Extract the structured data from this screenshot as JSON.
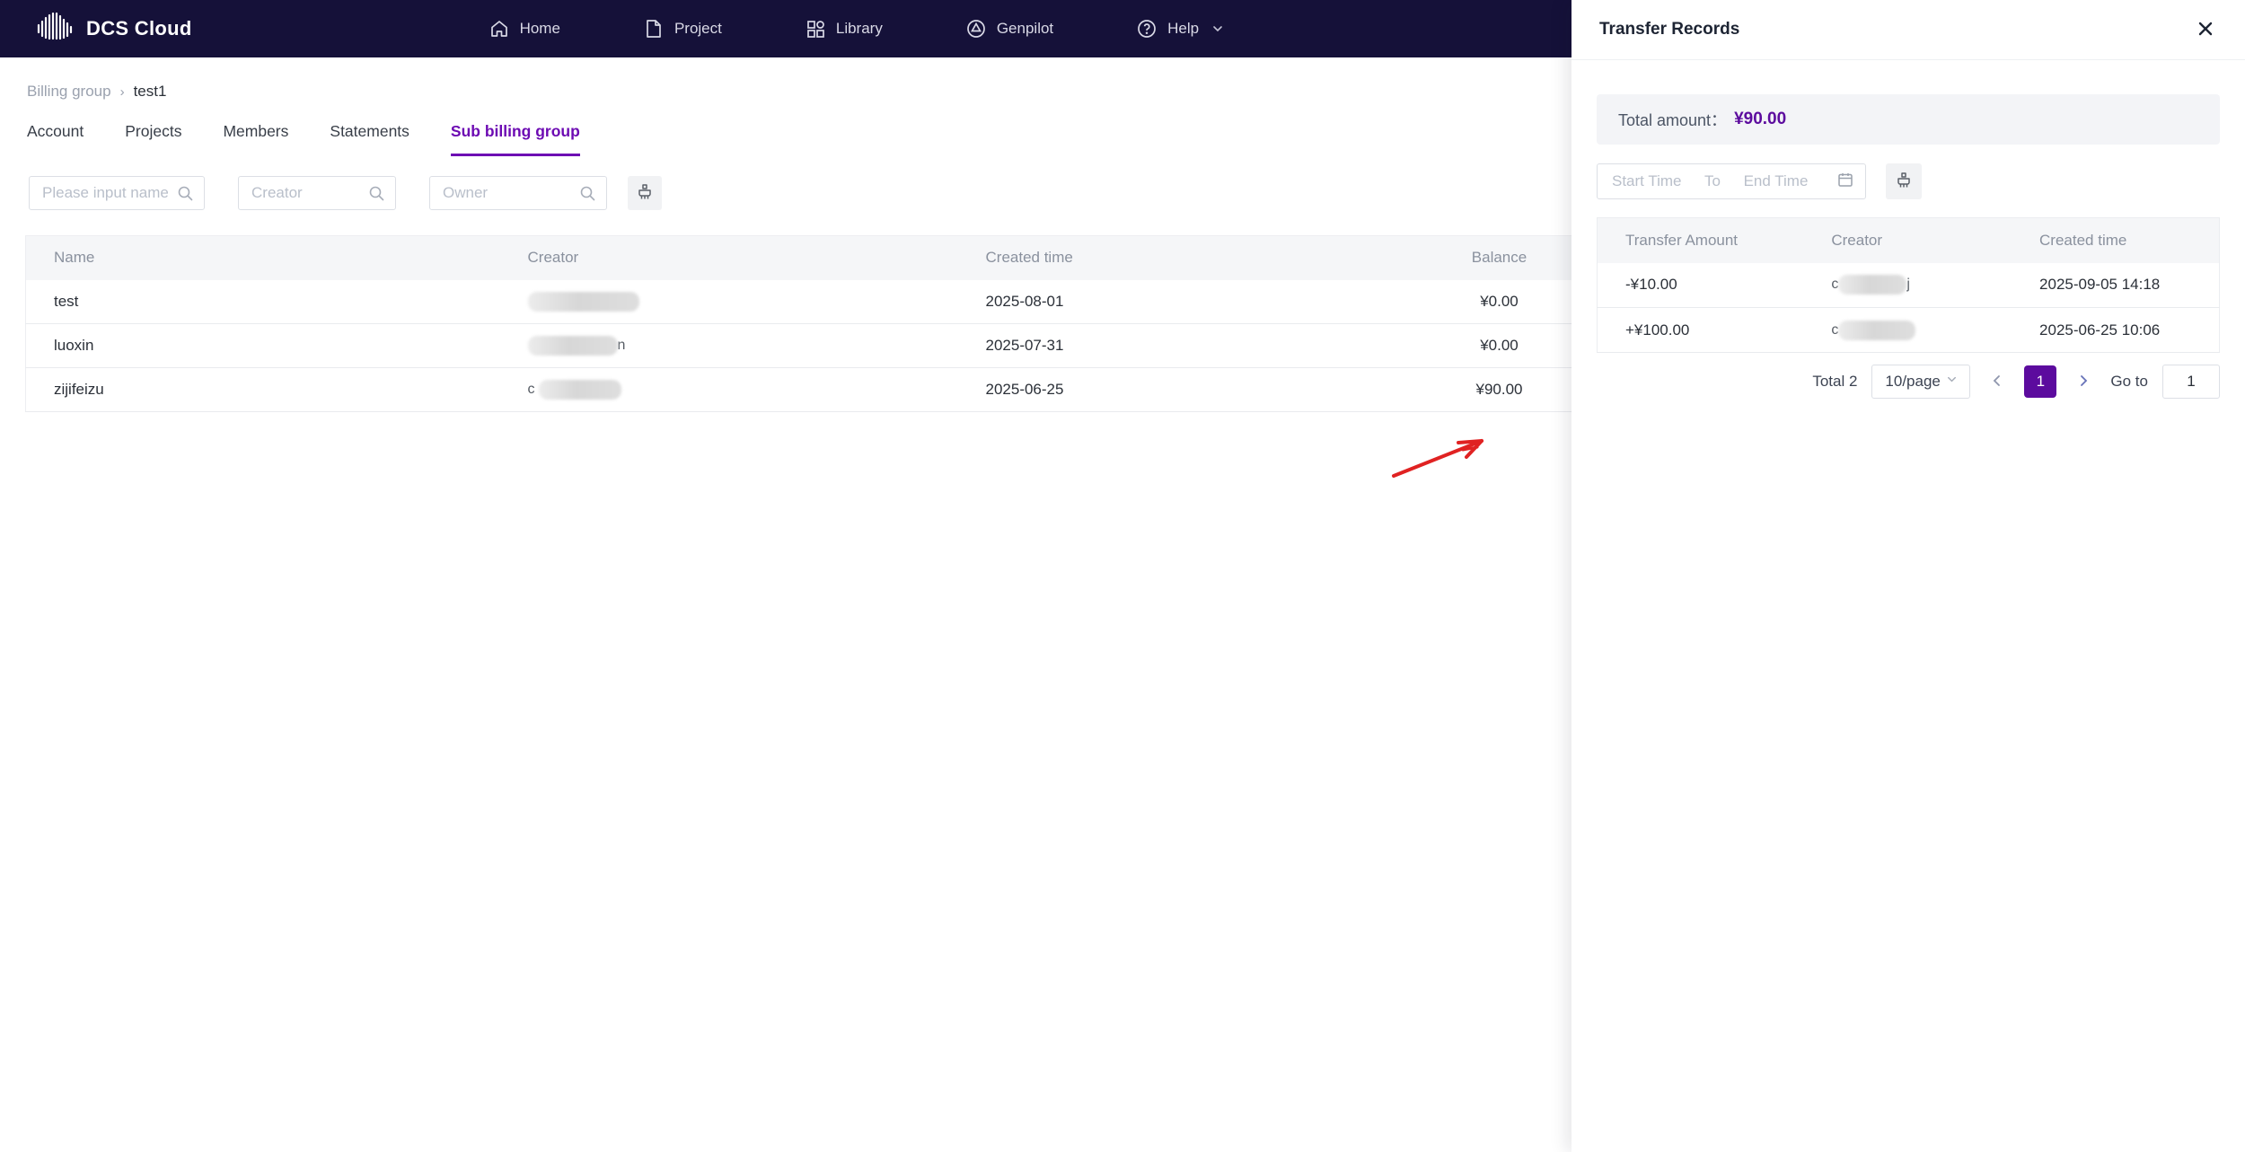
{
  "nav": {
    "brand": "DCS Cloud",
    "items": [
      {
        "label": "Home"
      },
      {
        "label": "Project"
      },
      {
        "label": "Library"
      },
      {
        "label": "Genpilot"
      },
      {
        "label": "Help"
      }
    ]
  },
  "breadcrumb": {
    "parent": "Billing group",
    "separator": "›",
    "current": "test1"
  },
  "tabs": [
    {
      "label": "Account"
    },
    {
      "label": "Projects"
    },
    {
      "label": "Members"
    },
    {
      "label": "Statements"
    },
    {
      "label": "Sub billing group",
      "active": true
    }
  ],
  "filters": {
    "name_placeholder": "Please input name",
    "creator_placeholder": "Creator",
    "owner_placeholder": "Owner"
  },
  "table": {
    "columns": [
      "Name",
      "Creator",
      "Created time",
      "Balance"
    ],
    "rows": [
      {
        "name": "test",
        "creator_redacted": true,
        "creator_suffix": "",
        "created": "2025-08-01",
        "balance": "¥0.00"
      },
      {
        "name": "luoxin",
        "creator_redacted": true,
        "creator_suffix": "n",
        "created": "2025-07-31",
        "balance": "¥0.00"
      },
      {
        "name": "zijifeizu",
        "creator_redacted": true,
        "creator_prefix": "c",
        "created": "2025-06-25",
        "balance": "¥90.00",
        "highlighted": true
      }
    ]
  },
  "drawer": {
    "title": "Transfer Records",
    "total_label": "Total amount：",
    "total_value": "¥90.00",
    "date_filter": {
      "start_placeholder": "Start Time",
      "separator": "To",
      "end_placeholder": "End Time"
    },
    "table": {
      "columns": [
        "Transfer Amount",
        "Creator",
        "Created time"
      ],
      "rows": [
        {
          "amount": "-¥10.00",
          "creator_prefix": "c",
          "creator_suffix": "j",
          "created": "2025-09-05 14:18"
        },
        {
          "amount": "+¥100.00",
          "creator_prefix": "c",
          "creator_suffix": "",
          "created": "2025-06-25 10:06"
        }
      ]
    },
    "pagination": {
      "total_text": "Total 2",
      "page_size": "10/page",
      "current_page": "1",
      "goto_label": "Go to",
      "goto_value": "1"
    }
  },
  "colors": {
    "nav_bg": "#151139",
    "accent_purple": "#5c0b9e",
    "tab_purple": "#6d0bb3",
    "arrow_red": "#e02222"
  }
}
